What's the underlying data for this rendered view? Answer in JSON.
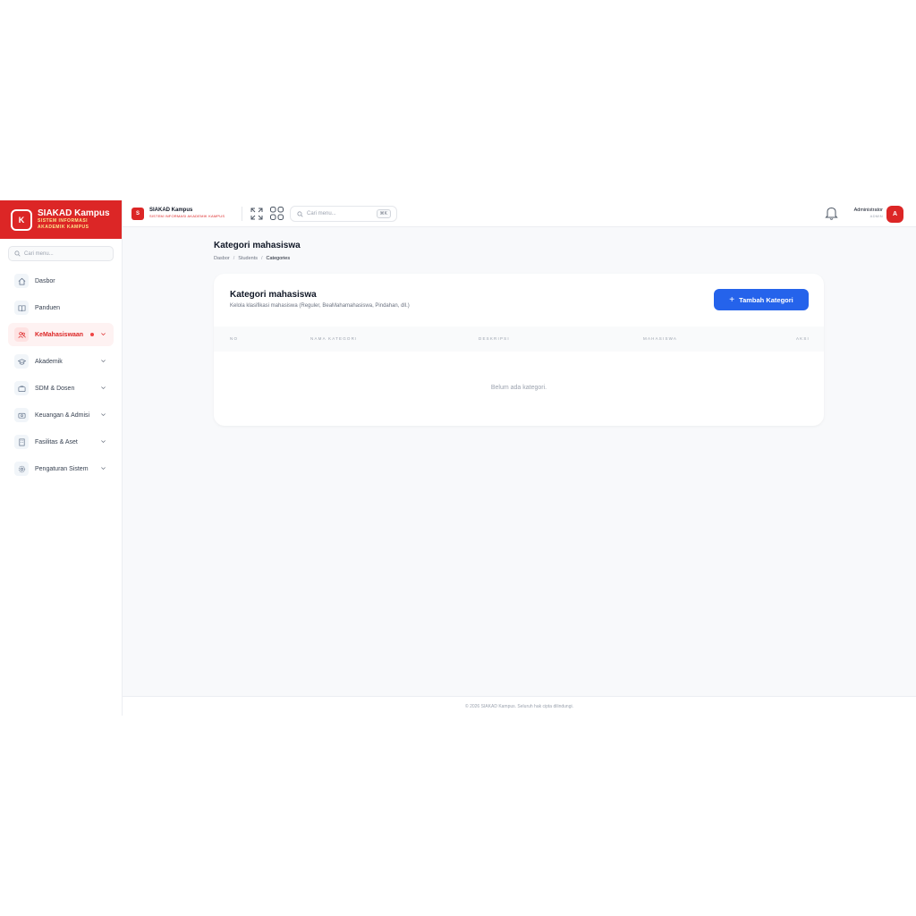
{
  "sidebar": {
    "brand_title": "SIAKAD Kampus",
    "brand_line1": "SISTEM INFORMASI",
    "brand_line2": "AKADEMIK KAMPUS",
    "brand_letter": "K",
    "search_placeholder": "Cari menu...",
    "items": [
      {
        "label": "Dasbor",
        "icon": "home-icon"
      },
      {
        "label": "Panduen",
        "icon": "book-icon"
      },
      {
        "label": "KeMahasiswaan",
        "icon": "users-icon",
        "active": true
      },
      {
        "label": "Akademik",
        "icon": "graduation-cap-icon"
      },
      {
        "label": "SDM & Dosen",
        "icon": "briefcase-icon"
      },
      {
        "label": "Keuangan & Admisi",
        "icon": "wallet-icon"
      },
      {
        "label": "Fasilitas & Aset",
        "icon": "building-icon"
      },
      {
        "label": "Pengaturan Sistem",
        "icon": "gear-icon"
      }
    ]
  },
  "topbar": {
    "logo_letter": "S",
    "title": "SIAKAD Kampus",
    "subtitle": "SISTEM INFORMASI AKADEMIK KAMPUS",
    "search_placeholder": "Cari menu...",
    "shortcut": "⌘K",
    "user_name": "Administrator",
    "user_role": "ADMIN",
    "avatar_letter": "A"
  },
  "main": {
    "page_title": "Kategori mahasiswa",
    "breadcrumb": [
      "Dasbor",
      "Students",
      "Categories"
    ],
    "card_title": "Kategori mahasiswa",
    "card_subtitle": "Kelola klasifikasi mahasiswa (Reguler, BeaMahamahasiswa, Pindahan, dll.)",
    "add_button": "Tambah Kategori",
    "columns": [
      "NO",
      "NAMA KATEGORI",
      "DESKRIPSI",
      "MAHASISWA",
      "AKSI"
    ],
    "empty_text": "Belum ada kategori."
  },
  "footer": {
    "text": "© 2026 SIAKAD Kampus. Seluruh hak cipta dilindungi."
  },
  "colors": {
    "brand": "#dc2626",
    "primary": "#2563eb",
    "bg": "#f8f9fb"
  }
}
